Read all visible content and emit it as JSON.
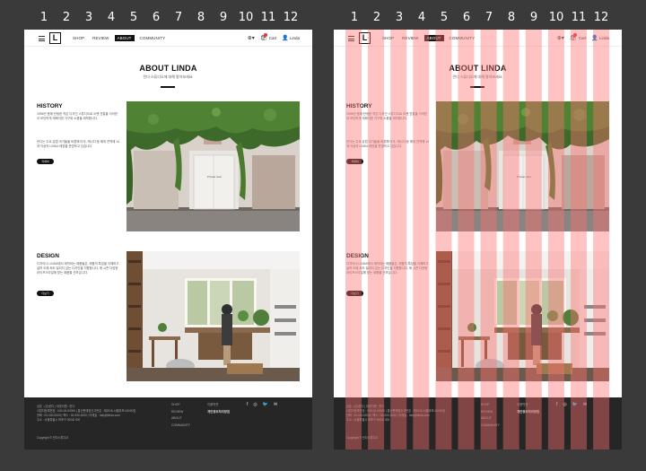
{
  "column_numbers": [
    "1",
    "2",
    "3",
    "4",
    "5",
    "6",
    "7",
    "8",
    "9",
    "10",
    "11",
    "12"
  ],
  "nav": {
    "logo": "L",
    "menu": [
      "SHOP",
      "REVIEW",
      "ABOUT",
      "COMMUNITY"
    ],
    "active_index": 2,
    "cart_label": "Cart",
    "user_label": "Linda"
  },
  "about": {
    "title": "ABOUT LINDA",
    "subtitle": "린다 스튜디오에 대해 알아보세요."
  },
  "history": {
    "title": "HISTORY",
    "text1": "1996년 봄에 탄생한 작은 디자인 스튜디오로 오랜 전통을 이어받아 모던하게 재해석한 가구와 소품을 제작합니다.",
    "text2": "린다는 주요 유럽 국가들을 비롯해 미국, 캐나다 등 해외 전역에 14개 이상의 LINDA 매장을 운영하고 있습니다.",
    "button": "자세히",
    "photo_caption": "Private door"
  },
  "design": {
    "title": "DESIGN",
    "text": "디자이너 LINDA에서 제작되는 제품들은, 제품의 특징을 이해하고 살려 오래 써도 질리지 않는 디자인을 지향합니다. 매 시즌 다양한 라이프스타일에 맞는 제품을 선보입니다.",
    "button": "더보기"
  },
  "footer": {
    "info_lines": [
      "상호 : (주)린다 | 대표자명 : 린다",
      "사업자등록번호 : 000-00-00000 | 통신판매업신고번호 : 제2016-서울마포-00000호",
      "전화 : 02-000-0000 | 팩스 : 02-000-0000 | 이메일 : help@linda.com",
      "주소 : 서울특별시 마포구 000로 000"
    ],
    "copyright": "Copyright © 린다스튜디오",
    "links": [
      "SHOP",
      "REVIEW",
      "ABOUT",
      "COMMUNITY"
    ],
    "policy": [
      "이용약관",
      "개인정보처리방침"
    ],
    "social": [
      "facebook-icon",
      "instagram-icon",
      "twitter-icon",
      "email-icon"
    ]
  },
  "colors": {
    "background": "#3a3a3a",
    "footer": "#262626",
    "accent": "#111111",
    "grid_overlay": "#ff6f6f"
  }
}
